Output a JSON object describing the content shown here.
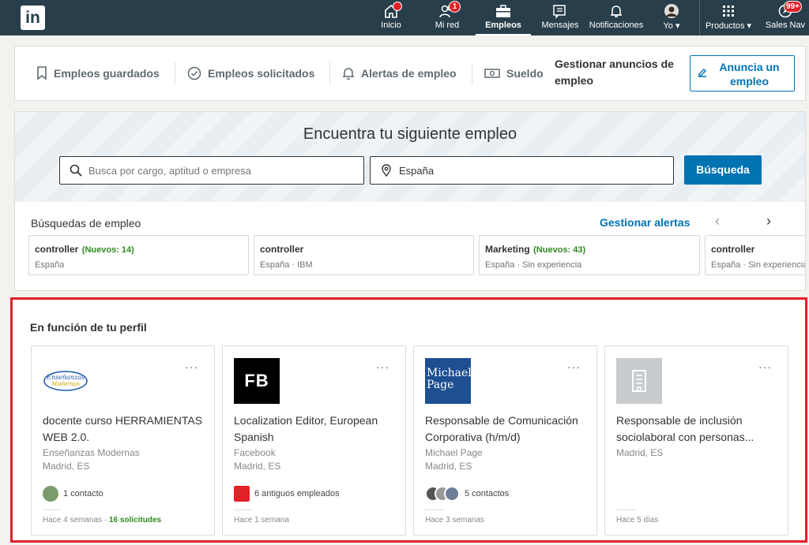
{
  "topnav": {
    "logo": "in",
    "items": [
      {
        "label": "Inicio",
        "icon": "home-icon"
      },
      {
        "label": "Mi red",
        "icon": "network-icon",
        "badge": "1"
      },
      {
        "label": "Empleos",
        "icon": "jobs-icon",
        "active": true
      },
      {
        "label": "Mensajes",
        "icon": "messages-icon"
      },
      {
        "label": "Notificaciones",
        "icon": "bell-icon"
      },
      {
        "label": "Yo",
        "icon": "avatar-icon"
      },
      {
        "label": "Productos",
        "icon": "grid-icon"
      },
      {
        "label": "Sales Nav",
        "icon": "compass-icon",
        "badge": "99+"
      }
    ]
  },
  "subnav": {
    "saved": "Empleos guardados",
    "applied": "Empleos solicitados",
    "alerts": "Alertas de empleo",
    "salary": "Sueldo",
    "manage": "Gestionar anuncios de empleo",
    "post_button": "Anuncia un empleo"
  },
  "search": {
    "title": "Encuentra tu siguiente empleo",
    "keyword_placeholder": "Busca por cargo, aptitud o empresa",
    "location_value": "España",
    "button": "Búsqueda",
    "saved_label": "Búsquedas de empleo",
    "manage_alerts": "Gestionar alertas",
    "prev": "‹",
    "next": "›",
    "cards": [
      {
        "title": "controller",
        "new": "(Nuevos: 14)",
        "sub": "España"
      },
      {
        "title": "controller",
        "new": "",
        "sub": "España · IBM"
      },
      {
        "title": "Marketing",
        "new": "(Nuevos: 43)",
        "sub": "España · Sin experiencia"
      },
      {
        "title": "controller",
        "new": "",
        "sub": "España · Sin experiencia"
      }
    ]
  },
  "recommendations": {
    "title": "En función de tu perfil",
    "jobs": [
      {
        "title": "docente curso HERRAMIENTAS WEB 2.0.",
        "company": "Enseñanzas Modernas",
        "location": "Madrid, ES",
        "connections": "1 contacto",
        "posted": "Hace 4 semanas",
        "applicants": "16 solicitudes",
        "logo_text": "Enseñanzas Modernas"
      },
      {
        "title": "Localization Editor, European Spanish",
        "company": "Facebook",
        "location": "Madrid, ES",
        "connections": "6 antiguos empleados",
        "posted": "Hace 1 semana",
        "applicants": "",
        "logo_text": "FB"
      },
      {
        "title": "Responsable de Comunicación Corporativa (h/m/d)",
        "company": "Michael Page",
        "location": "Madrid, ES",
        "connections": "5 contactos",
        "posted": "Hace 3 semanas",
        "applicants": "",
        "logo_text": "Michael Page"
      },
      {
        "title": "Responsable de inclusión sociolaboral con personas...",
        "company": "",
        "location": "Madrid, ES",
        "connections": "",
        "posted": "Hace 5 días",
        "applicants": "",
        "logo_text": ""
      }
    ],
    "more": "···"
  },
  "colors": {
    "nav": "#283e4a",
    "brand": "#0073b1",
    "highlight_border": "#e32126",
    "new_green": "#2e8a1e"
  }
}
